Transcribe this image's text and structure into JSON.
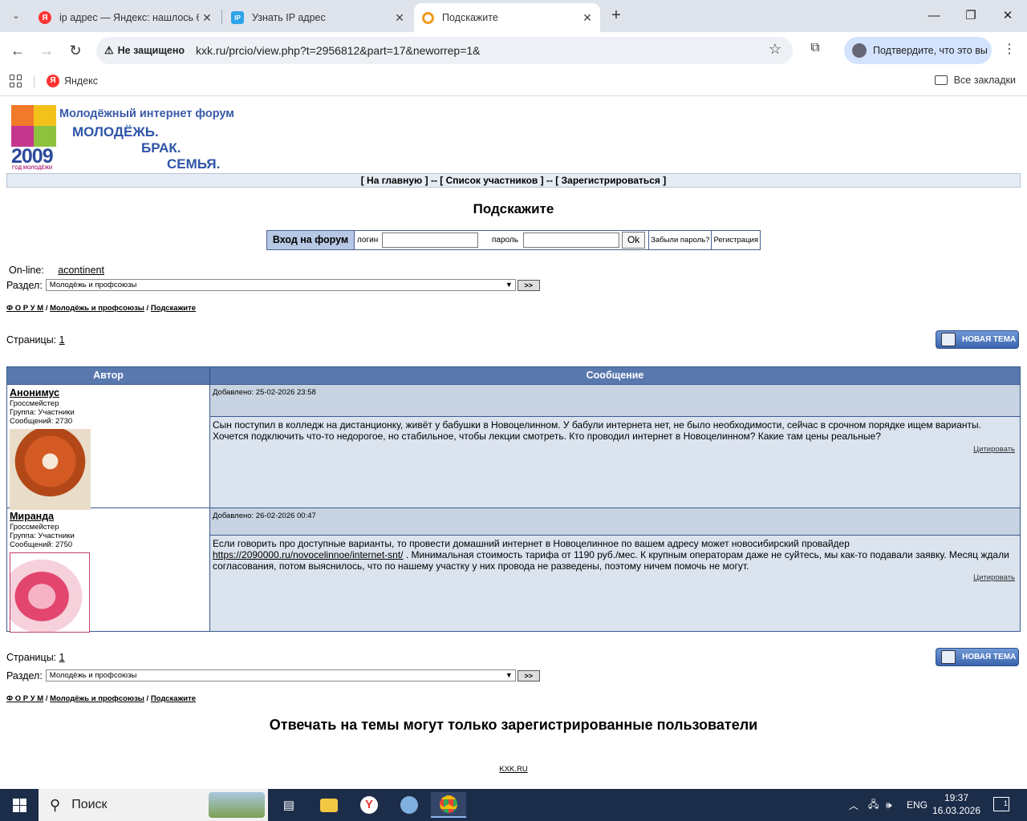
{
  "browser": {
    "tabs": [
      {
        "title": "ip адрес — Яндекс: нашлось 6",
        "favicon": "yandex-icon"
      },
      {
        "title": "Узнать IP адрес",
        "favicon": "ip-icon"
      },
      {
        "title": "Подскажите",
        "favicon": "ring-icon"
      }
    ],
    "security_label": "Не защищено",
    "url": "kxk.ru/prcio/view.php?t=2956812&part=17&neworrep=1&",
    "profile_label": "Подтвердите, что это вы",
    "bookmark_yandex": "Яндекс",
    "all_bookmarks": "Все закладки"
  },
  "site": {
    "logo": {
      "year": "2009",
      "year_caption": "ГОД МОЛОДЁЖИ",
      "line1": "Молодёжный интернет форум",
      "line2": "МОЛОДЁЖЬ.",
      "line3": "БРАК.",
      "line4": "СЕМЬЯ."
    },
    "menu": {
      "home": "[ На главную ]",
      "sep1": " -- ",
      "members": "[ Список участников ]",
      "sep2": " -- ",
      "register": "[ Зарегистрироваться ]"
    },
    "page_title": "Подскажите",
    "login": {
      "enter_label": "Вход на форум",
      "login_label": "логин",
      "password_label": "пароль",
      "login_value": "",
      "password_value": "",
      "ok_label": "Ok",
      "forgot_label": "Забыли пароль?",
      "register_label": "Регистрация"
    },
    "online_label": "On-line:",
    "online_user": "acontinent",
    "section_label": "Раздел:",
    "section_value": "Молодёжь и профсоюзы",
    "section_go": ">>",
    "breadcrumb": {
      "forum": "Ф О Р У М",
      "sep": " / ",
      "section": "Молодёжь и профсоюзы",
      "topic": "Подскажите"
    },
    "pages_label": "Страницы:",
    "pages_value": "1",
    "new_topic_label": "НОВАЯ ТЕМА",
    "table_headers": {
      "author": "Автор",
      "message": "Сообщение"
    },
    "posts": [
      {
        "author": "Анонимус",
        "rank": "Гроссмейстер",
        "group": "Группа: Участники",
        "messages": "Сообщений: 2730",
        "added": "Добавлено: 25-02-2026 23:58",
        "text": "Сын поступил в колледж на дистанционку, живёт у бабушки в Новоцелинном. У бабули интернета нет, не было необходимости, сейчас в срочном порядке ищем варианты. Хочется подключить что-то недорогое, но стабильное, чтобы лекции смотреть. Кто проводил интернет в Новоцелинном? Какие там цены реальные?",
        "quote": "Цитировать"
      },
      {
        "author": "Миранда",
        "rank": "Гроссмейстер",
        "group": "Группа: Участники",
        "messages": "Сообщений: 2750",
        "added": "Добавлено: 26-02-2026 00:47",
        "text_before": "Если говорить про доступные варианты, то провести домашний интернет в Новоцелинное по вашем адресу может новосибирский провайдер ",
        "link": "https://2090000.ru/novocelinnoe/internet-snt/",
        "text_after": " . Минимальная стоимость тарифа от 1190 руб./мес. К крупным операторам даже не суйтесь, мы как-то подавали заявку. Месяц ждали согласования, потом выяснилось, что по нашему участку у них провода не разведены, поэтому ничем помочь не могут.",
        "quote": "Цитировать"
      }
    ],
    "reply_notice": "Отвечать на темы могут только зарегистрированные пользователи",
    "footer": "KXK.RU"
  },
  "taskbar": {
    "search_label": "Поиск",
    "lang": "ENG",
    "time": "19:37",
    "date": "16.03.2026",
    "notifications": "1"
  }
}
